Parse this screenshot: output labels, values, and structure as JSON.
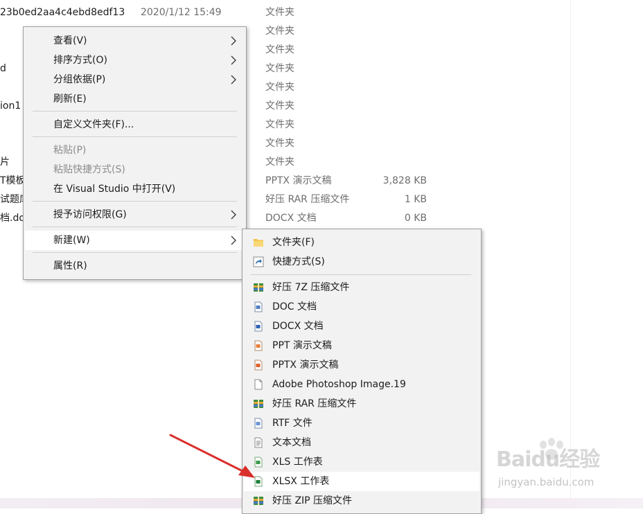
{
  "explorer": {
    "rows": [
      {
        "name": "23b0ed2aa4c4ebd8edf13",
        "date": "2020/1/12 15:49",
        "type": "文件夹",
        "size": ""
      },
      {
        "name": "",
        "date": "",
        "type": "文件夹",
        "size": ""
      },
      {
        "name": "",
        "date": "",
        "type": "文件夹",
        "size": ""
      },
      {
        "name": "d",
        "date": "",
        "type": "文件夹",
        "size": ""
      },
      {
        "name": "",
        "date": "",
        "type": "文件夹",
        "size": ""
      },
      {
        "name": "ion1",
        "date": "",
        "type": "文件夹",
        "size": ""
      },
      {
        "name": "",
        "date": "",
        "type": "文件夹",
        "size": ""
      },
      {
        "name": "",
        "date": "",
        "type": "文件夹",
        "size": ""
      },
      {
        "name": "片",
        "date": "",
        "type": "文件夹",
        "size": ""
      },
      {
        "name": "T模板",
        "date": "",
        "type": "PPTX 演示文稿",
        "size": "3,828 KB"
      },
      {
        "name": "试题库",
        "date": "",
        "type": "好压 RAR 压缩文件",
        "size": "1 KB"
      },
      {
        "name": "档.do",
        "date": "",
        "type": "DOCX 文档",
        "size": "0 KB"
      }
    ]
  },
  "context_menu": {
    "items": [
      {
        "label": "查看(V)"
      },
      {
        "label": "排序方式(O)"
      },
      {
        "label": "分组依据(P)"
      },
      {
        "label": "刷新(E)"
      },
      {
        "label": "自定义文件夹(F)..."
      },
      {
        "label": "粘贴(P)"
      },
      {
        "label": "粘贴快捷方式(S)"
      },
      {
        "label": "在 Visual Studio 中打开(V)"
      },
      {
        "label": "授予访问权限(G)"
      },
      {
        "label": "新建(W)"
      },
      {
        "label": "属性(R)"
      }
    ]
  },
  "new_submenu": {
    "items": [
      {
        "label": "文件夹(F)",
        "icon": "folder-icon"
      },
      {
        "label": "快捷方式(S)",
        "icon": "shortcut-icon"
      },
      {
        "label": "好压 7Z 压缩文件",
        "icon": "haozip-archive-icon"
      },
      {
        "label": "DOC 文档",
        "icon": "doc-file-icon"
      },
      {
        "label": "DOCX 文档",
        "icon": "docx-file-icon"
      },
      {
        "label": "PPT 演示文稿",
        "icon": "ppt-file-icon"
      },
      {
        "label": "PPTX 演示文稿",
        "icon": "pptx-file-icon"
      },
      {
        "label": "Adobe Photoshop Image.19",
        "icon": "blank-file-icon"
      },
      {
        "label": "好压 RAR 压缩文件",
        "icon": "haozip-archive-icon"
      },
      {
        "label": "RTF 文件",
        "icon": "rtf-file-icon"
      },
      {
        "label": "文本文档",
        "icon": "text-file-icon"
      },
      {
        "label": "XLS 工作表",
        "icon": "xls-file-icon"
      },
      {
        "label": "XLSX 工作表",
        "icon": "xlsx-file-icon"
      },
      {
        "label": "好压 ZIP 压缩文件",
        "icon": "haozip-archive-icon"
      }
    ]
  },
  "watermark": {
    "brand": "Baidu经验",
    "url": "jingyan.baidu.com"
  },
  "colors": {
    "annotation_arrow": "#d9302c",
    "menu_bg": "#f2f2f2",
    "hover_bg": "#ffffff"
  }
}
